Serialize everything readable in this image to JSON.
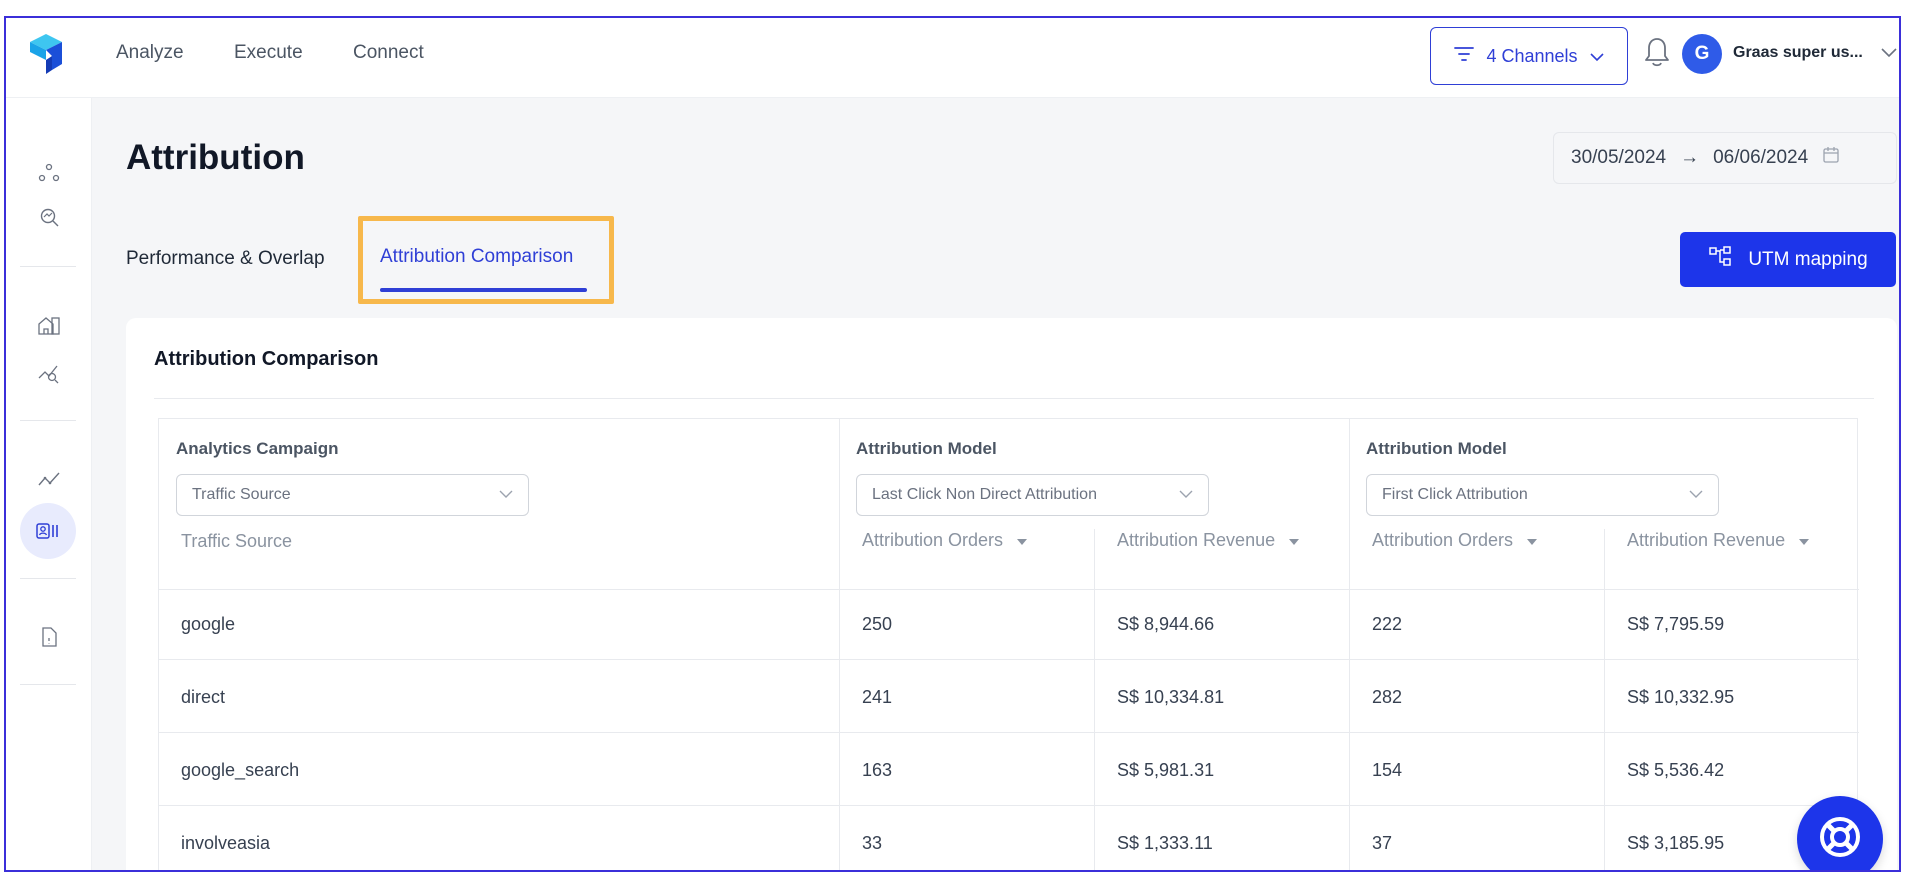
{
  "nav": {
    "items": [
      "Analyze",
      "Execute",
      "Connect"
    ],
    "channels_label": "4 Channels",
    "user_initial": "G",
    "user_name": "Graas super us..."
  },
  "page": {
    "title": "Attribution",
    "date_from": "30/05/2024",
    "date_arrow": "→",
    "date_to": "06/06/2024"
  },
  "tabs": {
    "performance": "Performance & Overlap",
    "comparison": "Attribution Comparison"
  },
  "utm_button": "UTM mapping",
  "card": {
    "title": "Attribution Comparison",
    "groups": {
      "campaign": {
        "label": "Analytics Campaign",
        "selected": "Traffic Source"
      },
      "model1": {
        "label": "Attribution Model",
        "selected": "Last Click Non Direct Attribution"
      },
      "model2": {
        "label": "Attribution Model",
        "selected": "First Click Attribution"
      }
    },
    "headers": {
      "source": "Traffic Source",
      "orders1": "Attribution Orders",
      "revenue1": "Attribution Revenue",
      "orders2": "Attribution Orders",
      "revenue2": "Attribution Revenue"
    },
    "rows": [
      {
        "source": "google",
        "orders1": "250",
        "revenue1": "S$ 8,944.66",
        "orders2": "222",
        "revenue2": "S$ 7,795.59"
      },
      {
        "source": "direct",
        "orders1": "241",
        "revenue1": "S$ 10,334.81",
        "orders2": "282",
        "revenue2": "S$ 10,332.95"
      },
      {
        "source": "google_search",
        "orders1": "163",
        "revenue1": "S$ 5,981.31",
        "orders2": "154",
        "revenue2": "S$ 5,536.42"
      },
      {
        "source": "involveasia",
        "orders1": "33",
        "revenue1": "S$ 1,333.11",
        "orders2": "37",
        "revenue2": "S$ 3,185.95"
      }
    ]
  },
  "colors": {
    "accent": "#1d35ea",
    "highlight": "#f7b84c",
    "frame": "#3b2fd9"
  }
}
